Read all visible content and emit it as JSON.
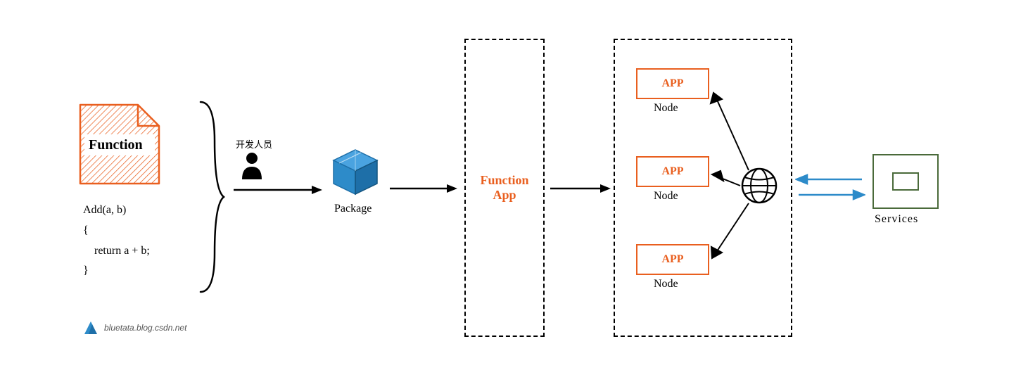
{
  "file": {
    "title": "Function",
    "code_line1": "Add(a, b)",
    "code_line2": "{",
    "code_line3": "    return a + b;",
    "code_line4": "}"
  },
  "developer": {
    "label": "开发人员"
  },
  "package": {
    "label": "Package"
  },
  "functionApp": {
    "label": "Function\nApp"
  },
  "cluster": {
    "nodes": [
      {
        "app": "APP",
        "label": "Node"
      },
      {
        "app": "APP",
        "label": "Node"
      },
      {
        "app": "APP",
        "label": "Node"
      }
    ]
  },
  "services": {
    "label": "Services"
  },
  "watermark": "bluetata.blog.csdn.net"
}
